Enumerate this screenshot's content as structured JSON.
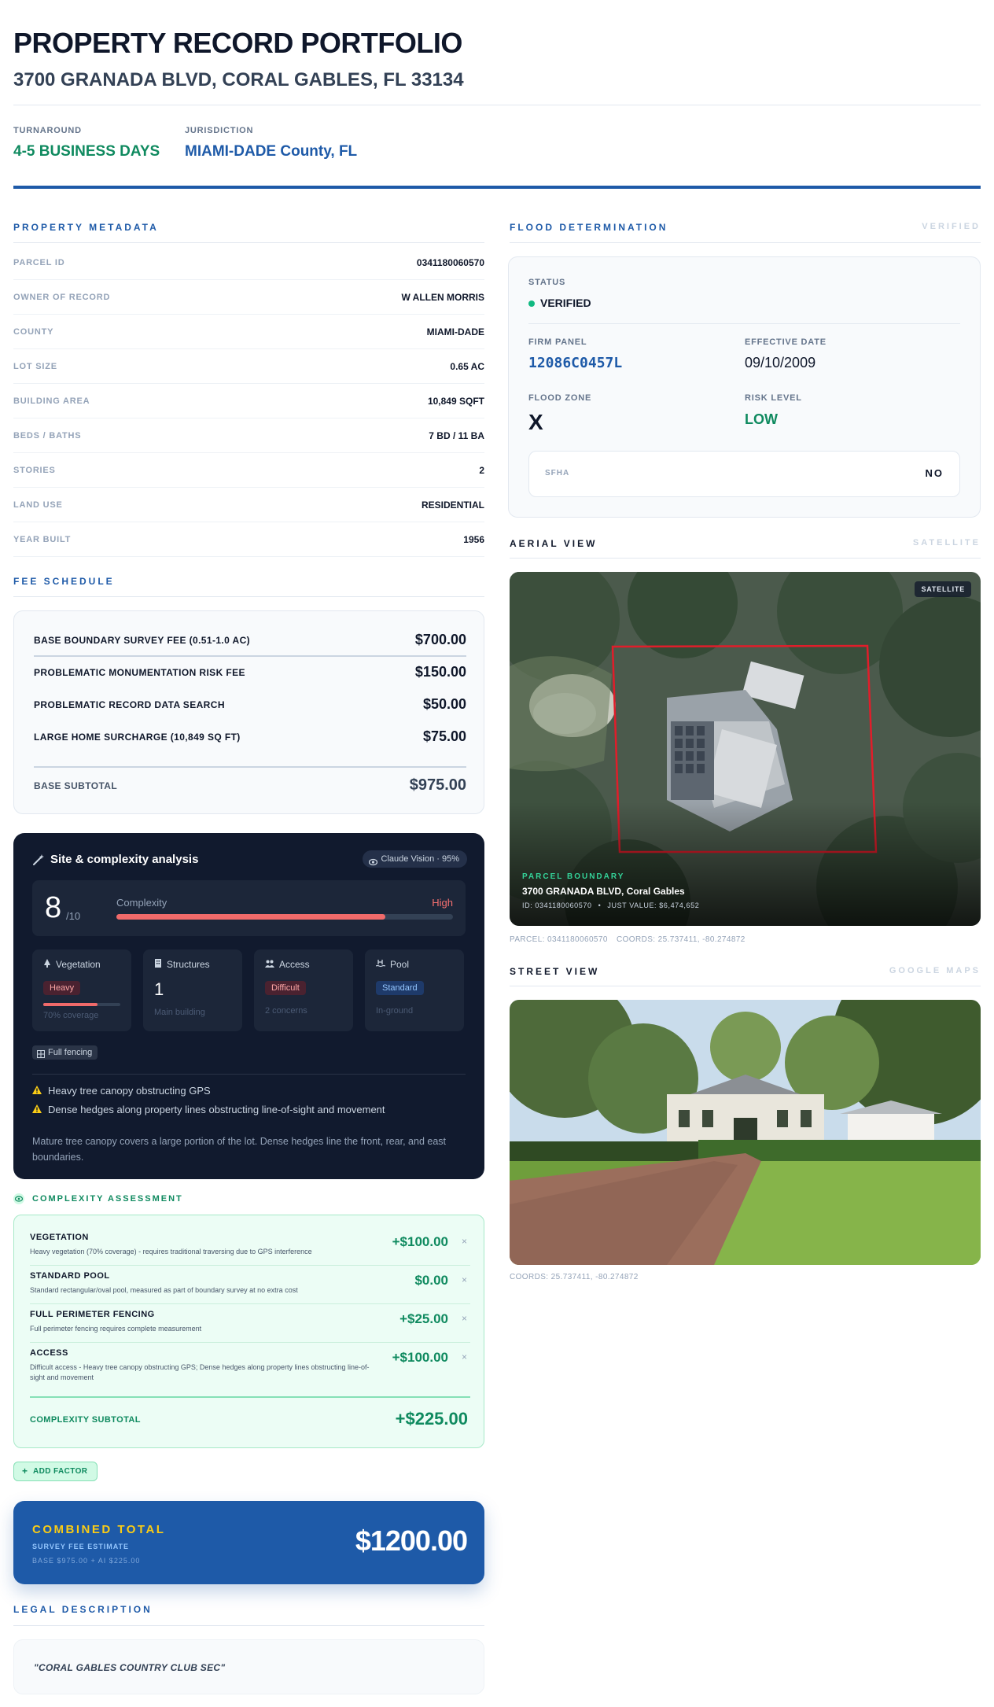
{
  "header": {
    "title": "PROPERTY RECORD PORTFOLIO",
    "address": "3700 GRANADA BLVD, CORAL GABLES, FL 33134",
    "turnaround_label": "TURNAROUND",
    "turnaround_value": "4-5 BUSINESS DAYS",
    "jurisdiction_label": "JURISDICTION",
    "jurisdiction_value": "MIAMI-DADE County, FL"
  },
  "colors": {
    "accent_blue": "#1e5aa8",
    "green": "#0f8a5f",
    "dark": "#111a2e",
    "red_boundary": "#e11d2a"
  },
  "property_metadata": {
    "heading": "PROPERTY METADATA",
    "rows": [
      {
        "k": "PARCEL ID",
        "v": "0341180060570"
      },
      {
        "k": "OWNER OF RECORD",
        "v": "W ALLEN MORRIS"
      },
      {
        "k": "COUNTY",
        "v": "MIAMI-DADE"
      },
      {
        "k": "LOT SIZE",
        "v": "0.65 AC"
      },
      {
        "k": "BUILDING AREA",
        "v": "10,849 SQFT"
      },
      {
        "k": "BEDS / BATHS",
        "v": "7 BD / 11 BA"
      },
      {
        "k": "STORIES",
        "v": "2"
      },
      {
        "k": "LAND USE",
        "v": "RESIDENTIAL"
      },
      {
        "k": "YEAR BUILT",
        "v": "1956"
      }
    ]
  },
  "fee_schedule": {
    "heading": "FEE SCHEDULE",
    "rows": [
      {
        "k": "BASE BOUNDARY SURVEY FEE (0.51-1.0 AC)",
        "v": "$700.00"
      },
      {
        "k": "PROBLEMATIC MONUMENTATION RISK FEE",
        "v": "$150.00"
      },
      {
        "k": "PROBLEMATIC RECORD DATA SEARCH",
        "v": "$50.00"
      },
      {
        "k": "LARGE HOME SURCHARGE (10,849 SQ FT)",
        "v": "$75.00"
      }
    ],
    "subtotal_label": "BASE SUBTOTAL",
    "subtotal_value": "$975.00"
  },
  "analysis": {
    "title": "Site & complexity analysis",
    "badge": "Claude Vision · 95%",
    "score": "8",
    "score_max": "/10",
    "complexity_label": "Complexity",
    "complexity_level": "High",
    "complexity_fraction": 0.8,
    "cards": {
      "vegetation": {
        "label": "Vegetation",
        "pill": "Heavy",
        "foot": "70% coverage",
        "coverage": 0.7
      },
      "structures": {
        "label": "Structures",
        "count": "1",
        "foot": "Main building"
      },
      "access": {
        "label": "Access",
        "pill": "Difficult",
        "foot": "2 concerns"
      },
      "pool": {
        "label": "Pool",
        "pill": "Standard",
        "foot": "In-ground"
      }
    },
    "fence_tag": "Full fencing",
    "warnings": [
      "Heavy tree canopy obstructing GPS",
      "Dense hedges along property lines obstructing line-of-sight and movement"
    ],
    "summary": "Mature tree canopy covers a large portion of the lot. Dense hedges line the front, rear, and east boundaries."
  },
  "complexity_assessment": {
    "heading": "COMPLEXITY ASSESSMENT",
    "items": [
      {
        "t": "VEGETATION",
        "d": "Heavy vegetation (70% coverage) - requires traditional traversing due to GPS interference",
        "v": "+$100.00"
      },
      {
        "t": "STANDARD POOL",
        "d": "Standard rectangular/oval pool, measured as part of boundary survey at no extra cost",
        "v": "$0.00"
      },
      {
        "t": "FULL PERIMETER FENCING",
        "d": "Full perimeter fencing requires complete measurement",
        "v": "+$25.00"
      },
      {
        "t": "ACCESS",
        "d": "Difficult access - Heavy tree canopy obstructing GPS; Dense hedges along property lines obstructing line-of-sight and movement",
        "v": "+$100.00"
      }
    ],
    "remove_glyph": "×",
    "subtotal_label": "COMPLEXITY SUBTOTAL",
    "subtotal_value": "+$225.00",
    "add_factor": "ADD FACTOR"
  },
  "combined": {
    "title": "COMBINED TOTAL",
    "sub": "SURVEY FEE ESTIMATE",
    "breakdown": "BASE $975.00 + AI $225.00",
    "total": "$1200.00"
  },
  "legal": {
    "heading": "LEGAL DESCRIPTION",
    "text": "\"CORAL GABLES COUNTRY CLUB SEC\""
  },
  "flood": {
    "heading": "FLOOD DETERMINATION",
    "aux": "VERIFIED",
    "status_label": "STATUS",
    "status_value": "VERIFIED",
    "firm_label": "FIRM PANEL",
    "firm_value": "12086C0457L",
    "eff_label": "EFFECTIVE DATE",
    "eff_value": "09/10/2009",
    "zone_label": "FLOOD ZONE",
    "zone_value": "X",
    "risk_label": "RISK LEVEL",
    "risk_value": "LOW",
    "sfha_label": "SFHA",
    "sfha_value": "NO"
  },
  "aerial": {
    "heading": "AERIAL VIEW",
    "aux": "SATELLITE",
    "tag": "SATELLITE",
    "boundary_label": "PARCEL BOUNDARY",
    "address": "3700 GRANADA BLVD, Coral Gables",
    "id_line": "ID: 0341180060570",
    "value_line": "JUST VALUE: $6,474,652",
    "caption_parcel": "PARCEL: 0341180060570",
    "caption_coords": "COORDS: 25.737411, -80.274872"
  },
  "street": {
    "heading": "STREET VIEW",
    "aux": "GOOGLE MAPS",
    "caption": "COORDS: 25.737411, -80.274872"
  }
}
